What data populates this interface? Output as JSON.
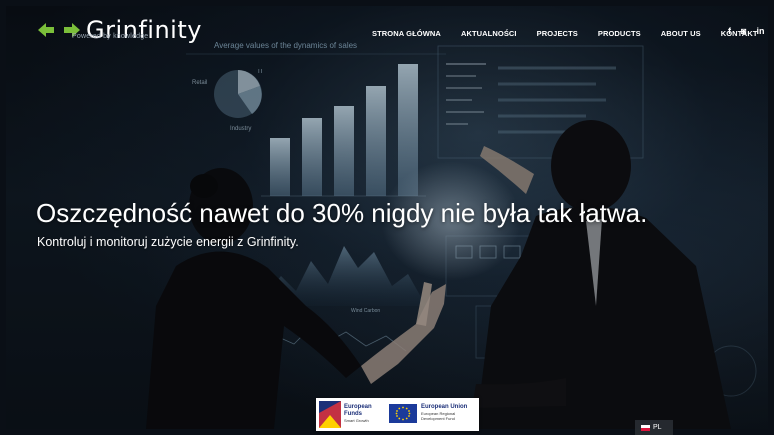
{
  "brand": {
    "name": "Grinfinity",
    "tagline": "Powered by knowledge",
    "accent_color": "#7bbf3a"
  },
  "nav": {
    "items": [
      {
        "id": "home",
        "label": "STRONA GŁÓWNA"
      },
      {
        "id": "news",
        "label": "AKTUALNOŚCI"
      },
      {
        "id": "projects",
        "label": "PROJECTS"
      },
      {
        "id": "products",
        "label": "PRODUCTS"
      },
      {
        "id": "about",
        "label": "ABOUT US"
      },
      {
        "id": "contact",
        "label": "KONTAKT"
      }
    ],
    "social": [
      {
        "id": "facebook",
        "icon": "facebook-icon",
        "glyph": "f"
      },
      {
        "id": "instagram",
        "icon": "instagram-icon",
        "glyph": "◙"
      },
      {
        "id": "linkedin",
        "icon": "linkedin-icon",
        "glyph": "in"
      }
    ]
  },
  "hero": {
    "headline": "Oszczędność nawet do 30% nigdy nie była tak łatwa.",
    "subline": "Kontroluj i monitoruj zużycie energii z Grinfinity.",
    "bg_chart_title": "Average values of the dynamics of sales",
    "bg_pie_labels": [
      "IT",
      "Retail",
      "Industry"
    ],
    "bg_wave_label": "Wind Carbon"
  },
  "footer": {
    "eu_funds_title": "European\nFunds",
    "eu_funds_sub": "Smart Growth",
    "eu_union_title": "European Union",
    "eu_union_sub": "European Regional Development Fund",
    "language": "PL"
  }
}
